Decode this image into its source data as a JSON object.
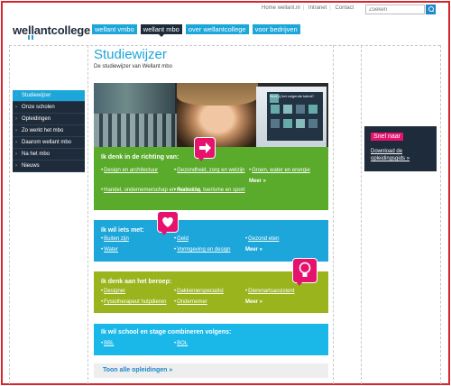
{
  "header": {
    "logo_text": "wellantcollege",
    "top_links": [
      "Home wellant.nl",
      "Intranet",
      "Contact"
    ],
    "search_placeholder": "Zoeken"
  },
  "nav": [
    "wellant vmbo",
    "wellant mbo",
    "over wellantcollege",
    "voor bedrijven"
  ],
  "page": {
    "title": "Studiewijzer",
    "subtitle": "De studiewijzer van Wellant mbo"
  },
  "sidebar": {
    "items": [
      {
        "label": "Studiewijzer",
        "active": true
      },
      {
        "label": "Onze scholen"
      },
      {
        "label": "Opleidingen"
      },
      {
        "label": "Zo werkt het mbo"
      },
      {
        "label": "Daarom wellant mbo"
      },
      {
        "label": "Na het mbo"
      },
      {
        "label": "Nieuws"
      }
    ]
  },
  "hero": {
    "book_title": "Bent jij het volgende talent?"
  },
  "direction": {
    "heading": "Ik denk in de richting van:",
    "links": [
      "Design en architectuur",
      "Gezondheid, zorg en welzijn",
      "Groen, water en energie",
      "Handel, ondernemerschap en marketing",
      "Recreatie, toerisme en sport"
    ],
    "more": "Meer »"
  },
  "likes": {
    "heading": "Ik wil iets met:",
    "links": [
      "Buiten zijn",
      "Geld",
      "Gezond eten",
      "Water",
      "Vormgeving en design"
    ],
    "more": "Meer »"
  },
  "profession": {
    "heading": "Ik denk aan het beroep:",
    "links": [
      "Designer",
      "Dakkenierspecialist",
      "Dierenartsassistent",
      "Fysiotherapeut hulpdieren",
      "Ondernemer"
    ],
    "more": "Meer »"
  },
  "combine": {
    "heading": "Ik wil school en stage combineren volgens:",
    "links": [
      "BBL",
      "BOL"
    ]
  },
  "all_link": "Toon alle opleidingen »",
  "quick": {
    "label": "Snel naar",
    "link": "Download de opleidingsgids »"
  },
  "colors": {
    "accent": "#1ca6d9",
    "dark": "#1e2b3a",
    "green": "#5aaa2b",
    "lime": "#9ab41e",
    "pink": "#e5126e"
  }
}
